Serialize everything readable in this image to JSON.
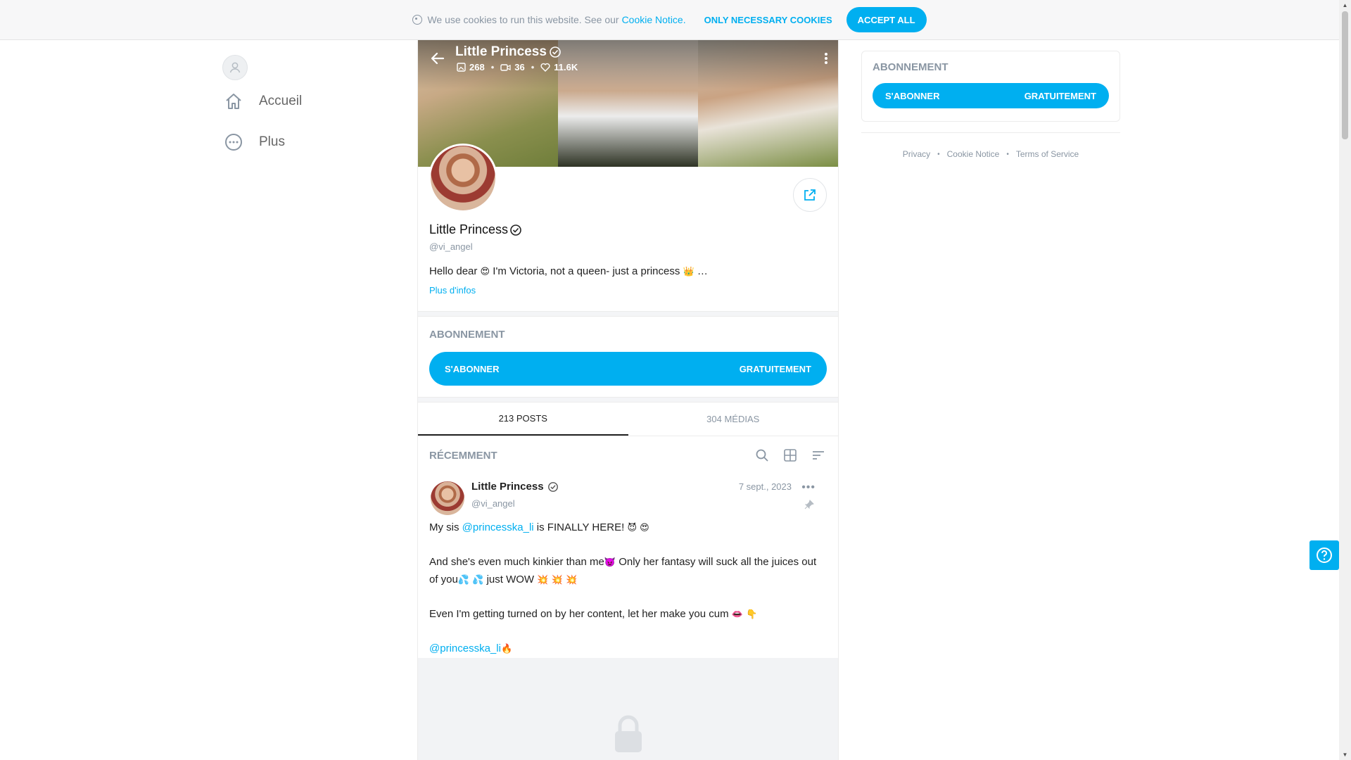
{
  "cookie_bar": {
    "text": "We use cookies to run this website. See our",
    "link": "Cookie Notice",
    "dot": ".",
    "necessary_label": "ONLY NECESSARY COOKIES",
    "accept_label": "ACCEPT ALL"
  },
  "sidebar": {
    "items": [
      {
        "label": "Accueil",
        "icon": "home-icon"
      },
      {
        "label": "Plus",
        "icon": "more-circle-icon"
      }
    ]
  },
  "cover": {
    "title": "Little Princess",
    "stats": {
      "photos": "268",
      "videos": "36",
      "likes": "11.6K"
    }
  },
  "profile": {
    "name": "Little Princess",
    "handle": "@vi_angel",
    "bio_start": "Hello dear",
    "bio_middle": "I'm Victoria, not a queen- just a princess",
    "bio_end": "…",
    "more_label": "Plus d'infos"
  },
  "subscription": {
    "title": "ABONNEMENT",
    "button_left": "S'ABONNER",
    "button_right": "GRATUITEMENT"
  },
  "tabs": [
    {
      "label": "213 POSTS",
      "active": true
    },
    {
      "label": "304 MÉDIAS",
      "active": false
    }
  ],
  "recent": {
    "title": "RÉCEMMENT"
  },
  "post": {
    "author": "Little Princess",
    "handle": "@vi_angel",
    "date": "7 sept., 2023",
    "line1_prefix": "My sis",
    "line1_mention": "@princesska_li",
    "line1_suffix": "is FINALLY HERE!",
    "line2a": "And she's even much kinkier than me",
    "line2b": "Only her fantasy will suck all the juices out of you",
    "line2c": "just WOW",
    "line3": "Even I'm getting turned on by her content, let her make you cum",
    "line4_mention": "@princesska_li"
  },
  "right_panel": {
    "title": "ABONNEMENT",
    "button_left": "S'ABONNER",
    "button_right": "GRATUITEMENT",
    "footer_links": [
      "Privacy",
      "Cookie Notice",
      "Terms of Service"
    ]
  },
  "colors": {
    "accent": "#00aff0",
    "muted": "#8a96a3"
  }
}
